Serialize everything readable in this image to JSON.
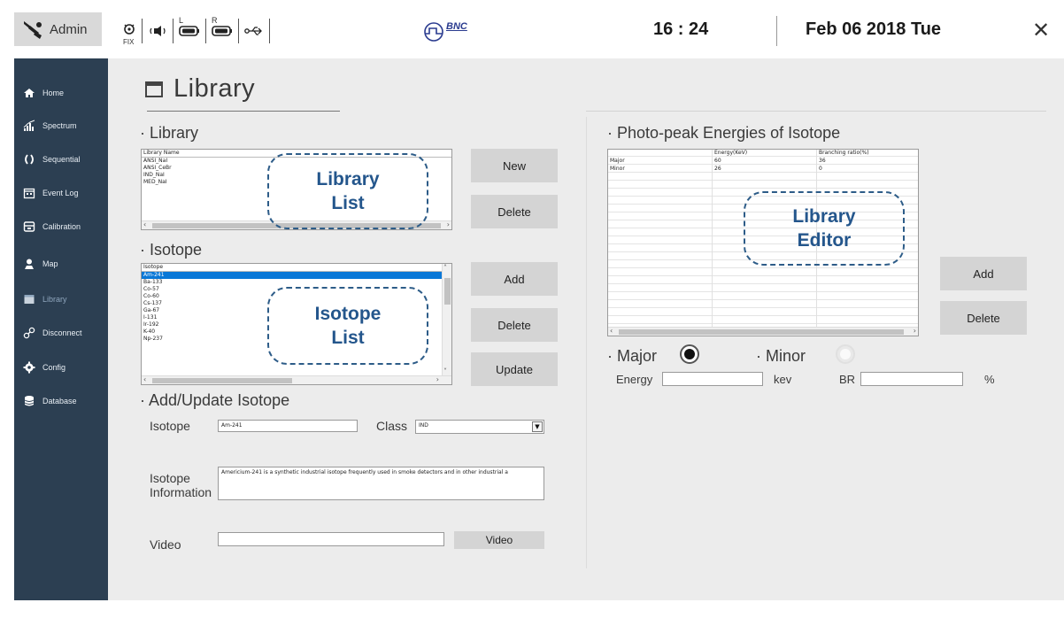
{
  "topbar": {
    "user_label": "Admin",
    "fix_label": "FIX",
    "left_label": "L",
    "right_label": "R",
    "logo_text": "BNC",
    "time": "16 : 24",
    "date": "Feb 06 2018 Tue",
    "close_glyph": "✕"
  },
  "sidebar": {
    "items": [
      {
        "label": "Home",
        "icon": "home-icon"
      },
      {
        "label": "Spectrum",
        "icon": "spectrum-icon"
      },
      {
        "label": "Sequential",
        "icon": "sequential-icon"
      },
      {
        "label": "Event Log",
        "icon": "event-log-icon"
      },
      {
        "label": "Calibration",
        "icon": "calibration-icon"
      },
      {
        "label": "Map",
        "icon": "map-icon"
      },
      {
        "label": "Library",
        "icon": "library-icon",
        "active": true
      },
      {
        "label": "Disconnect",
        "icon": "disconnect-icon"
      },
      {
        "label": "Config",
        "icon": "gear-icon"
      },
      {
        "label": "Database",
        "icon": "database-icon"
      }
    ]
  },
  "page": {
    "title": "Library"
  },
  "library_section": {
    "title": "· Library",
    "header": "Library Name",
    "rows": [
      "ANSI_NaI",
      "ANSI_CeBr",
      "IND_NaI",
      "MED_NaI"
    ],
    "new_label": "New",
    "delete_label": "Delete",
    "callout": "Library\nList"
  },
  "isotope_section": {
    "title": "· Isotope",
    "header": "Isotope",
    "rows": [
      "Am-241",
      "Ba-133",
      "Co-57",
      "Co-60",
      "Cs-137",
      "Ga-67",
      "I-131",
      "Ir-192",
      "K-40",
      "Np-237"
    ],
    "selected_index": 0,
    "add_label": "Add",
    "delete_label": "Delete",
    "update_label": "Update",
    "callout": "Isotope\nList"
  },
  "add_update": {
    "title": "· Add/Update Isotope",
    "isotope_label": "Isotope",
    "isotope_value": "Am-241",
    "class_label": "Class",
    "class_value": "IND",
    "info_label_line1": "Isotope",
    "info_label_line2": "Information",
    "info_value": "Americium-241 is a synthetic industrial isotope frequently used in smoke detectors and in other industrial a",
    "video_label": "Video",
    "video_value": "",
    "video_button": "Video"
  },
  "photopeak": {
    "title": "· Photo-peak Energies of Isotope",
    "columns": [
      "",
      "Energy(KeV)",
      "Branching ratio(%)"
    ],
    "rows": [
      [
        "Major",
        "60",
        "36"
      ],
      [
        "Minor",
        "26",
        "0"
      ]
    ],
    "callout": "Library\nEditor",
    "add_label": "Add",
    "delete_label": "Delete",
    "major_label": "· Major",
    "minor_label": "· Minor",
    "major_selected": true,
    "energy_label": "Energy",
    "energy_value": "",
    "energy_unit": "kev",
    "br_label": "BR",
    "br_value": "",
    "br_unit": "%"
  },
  "colors": {
    "sidebar_bg": "#2c3f52",
    "content_bg": "#ececec",
    "accent_blue": "#24568c",
    "selection_blue": "#0a78d7",
    "button_gray": "#d4d4d4"
  }
}
